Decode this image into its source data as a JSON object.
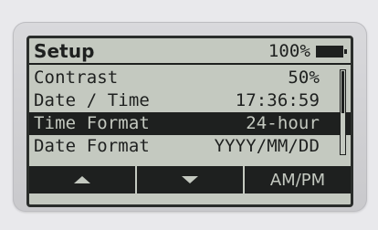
{
  "header": {
    "title": "Setup",
    "battery": "100%"
  },
  "menu": [
    {
      "label": "Contrast",
      "value": "50%"
    },
    {
      "label": "Date / Time",
      "value": "17:36:59"
    },
    {
      "label": "Time Format",
      "value": "24-hour",
      "selected": true
    },
    {
      "label": "Date Format",
      "value": "YYYY/MM/DD"
    }
  ],
  "softkeys": {
    "up_icon": "triangle-up-icon",
    "down_icon": "triangle-down-icon",
    "right_label": "AM/PM"
  },
  "colors": {
    "lcd_background": "#c4c9c0",
    "lcd_ink": "#1e201f",
    "bezel": "#d2d2d5"
  }
}
